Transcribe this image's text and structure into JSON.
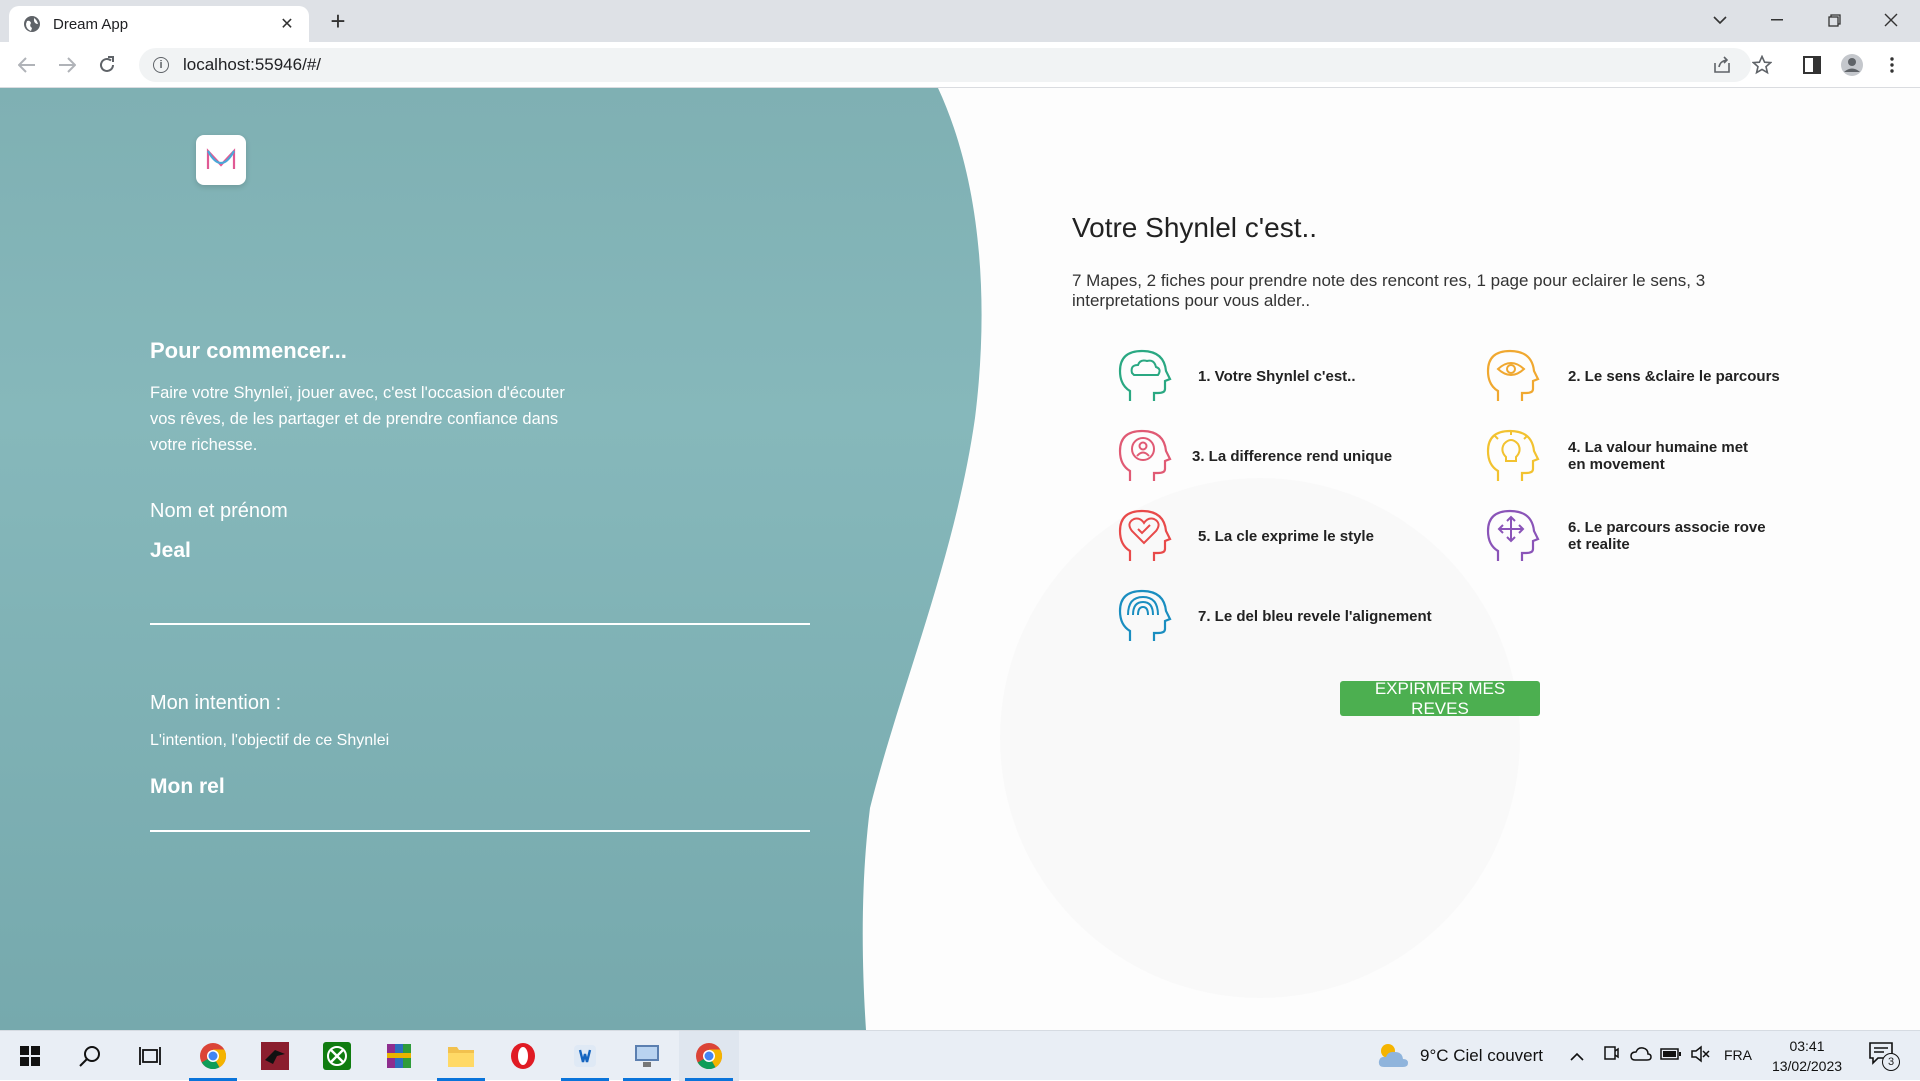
{
  "browser": {
    "tab_title": "Dream App",
    "url": "localhost:55946/#/"
  },
  "left": {
    "title": "Pour commencer...",
    "description": "Faire votre Shynleï, jouer avec, c'est l'occasion d'écouter vos rêves, de les partager et de prendre  confiance dans votre richesse.",
    "name_label": "Nom et prénom",
    "name_value": "Jeal",
    "intention_label": "Mon intention :",
    "intention_sub": "L'intention, l'objectif de ce Shynlei",
    "intention_value": "Mon rel"
  },
  "right": {
    "title": "Votre Shynlel c'est..",
    "description": "7 Mapes, 2 fiches pour prendre note des rencont res, 1 page pour eclairer le sens, 3 interpretations pour vous alder..",
    "features": [
      {
        "label": "1. Votre Shynlel c'est..",
        "icon": "head-cloud-icon",
        "color": "#2aa882"
      },
      {
        "label": "2. Le sens &claire le parcours",
        "icon": "head-eye-icon",
        "color": "#f0a830"
      },
      {
        "label": "3. La difference rend unique",
        "icon": "head-person-icon",
        "color": "#e05a74"
      },
      {
        "label": "4. La valour humaine met en movement",
        "icon": "head-bulb-icon",
        "color": "#f2c230"
      },
      {
        "label": "5.  La cle exprime le style",
        "icon": "head-heart-icon",
        "color": "#e84a4a"
      },
      {
        "label": "6. Le parcours associe rove et realite",
        "icon": "head-arrows-icon",
        "color": "#8a54b8"
      },
      {
        "label": "7. Le del bleu revele l'alignement",
        "icon": "head-rainbow-icon",
        "color": "#1a8ec0"
      }
    ],
    "cta_label": "EXPIRMER MES REVES"
  },
  "taskbar": {
    "weather": "9°C  Ciel couvert",
    "language": "FRA",
    "time": "03:41",
    "date": "13/02/2023",
    "notification_count": "3"
  },
  "colors": {
    "teal": "#80b1b4",
    "cta_green": "#4caf50"
  }
}
